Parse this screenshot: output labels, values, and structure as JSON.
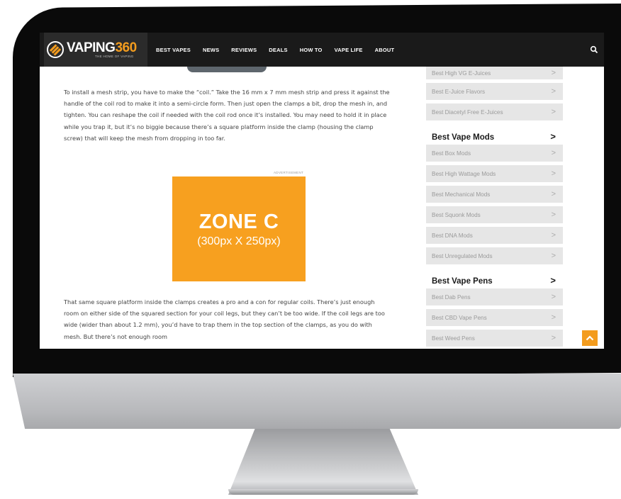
{
  "logo": {
    "name": "VAPING",
    "number": "360",
    "tagline": "THE HOME OF VAPING"
  },
  "nav": {
    "items": [
      "BEST VAPES",
      "NEWS",
      "REVIEWS",
      "DEALS",
      "HOW TO",
      "VAPE LIFE",
      "ABOUT"
    ],
    "search_icon": "search-icon"
  },
  "article": {
    "para1": "To install a mesh strip, you have to make the “coil.” Take the 16 mm x 7 mm mesh strip and press it against the handle of the coil rod to make it into a semi-circle form. Then just open the clamps a bit, drop the mesh in, and tighten. You can reshape the coil if needed with the coil rod once it’s installed. You may need to hold it in place while you trap it, but it’s no biggie because there’s a square platform inside the clamp (housing the clamp screw) that will keep the mesh from dropping in too far.",
    "para2": "That same square platform inside the clamps creates a pro and a con for regular coils. There’s just enough room on either side of the squared section for your coil legs, but they can’t be too wide. If the coil legs are too wide (wider than about 1.2 mm), you’d have to trap them in the top section of the clamps, as you do with mesh. But there’s not enough room"
  },
  "ad": {
    "label": "ADVERTISEMENT",
    "title": "ZONE C",
    "size": "(300px X 250px)"
  },
  "sidebar": {
    "group0": [
      "Best High VG E-Juices",
      "Best E-Juice Flavors",
      "Best Diacetyl Free E-Juices"
    ],
    "heading1": "Best Vape Mods",
    "group1": [
      "Best Box Mods",
      "Best High Wattage Mods",
      "Best Mechanical Mods",
      "Best Squonk Mods",
      "Best DNA Mods",
      "Best Unregulated Mods"
    ],
    "heading2": "Best Vape Pens",
    "group2": [
      "Best Dab Pens",
      "Best CBD Vape Pens",
      "Best Weed Pens"
    ],
    "chevron": ">"
  },
  "colors": {
    "accent": "#f39c1e",
    "nav_bg": "#1a1a1a",
    "ad_bg": "#f7a01f",
    "sidebar_item_bg": "#e6e6e6"
  }
}
